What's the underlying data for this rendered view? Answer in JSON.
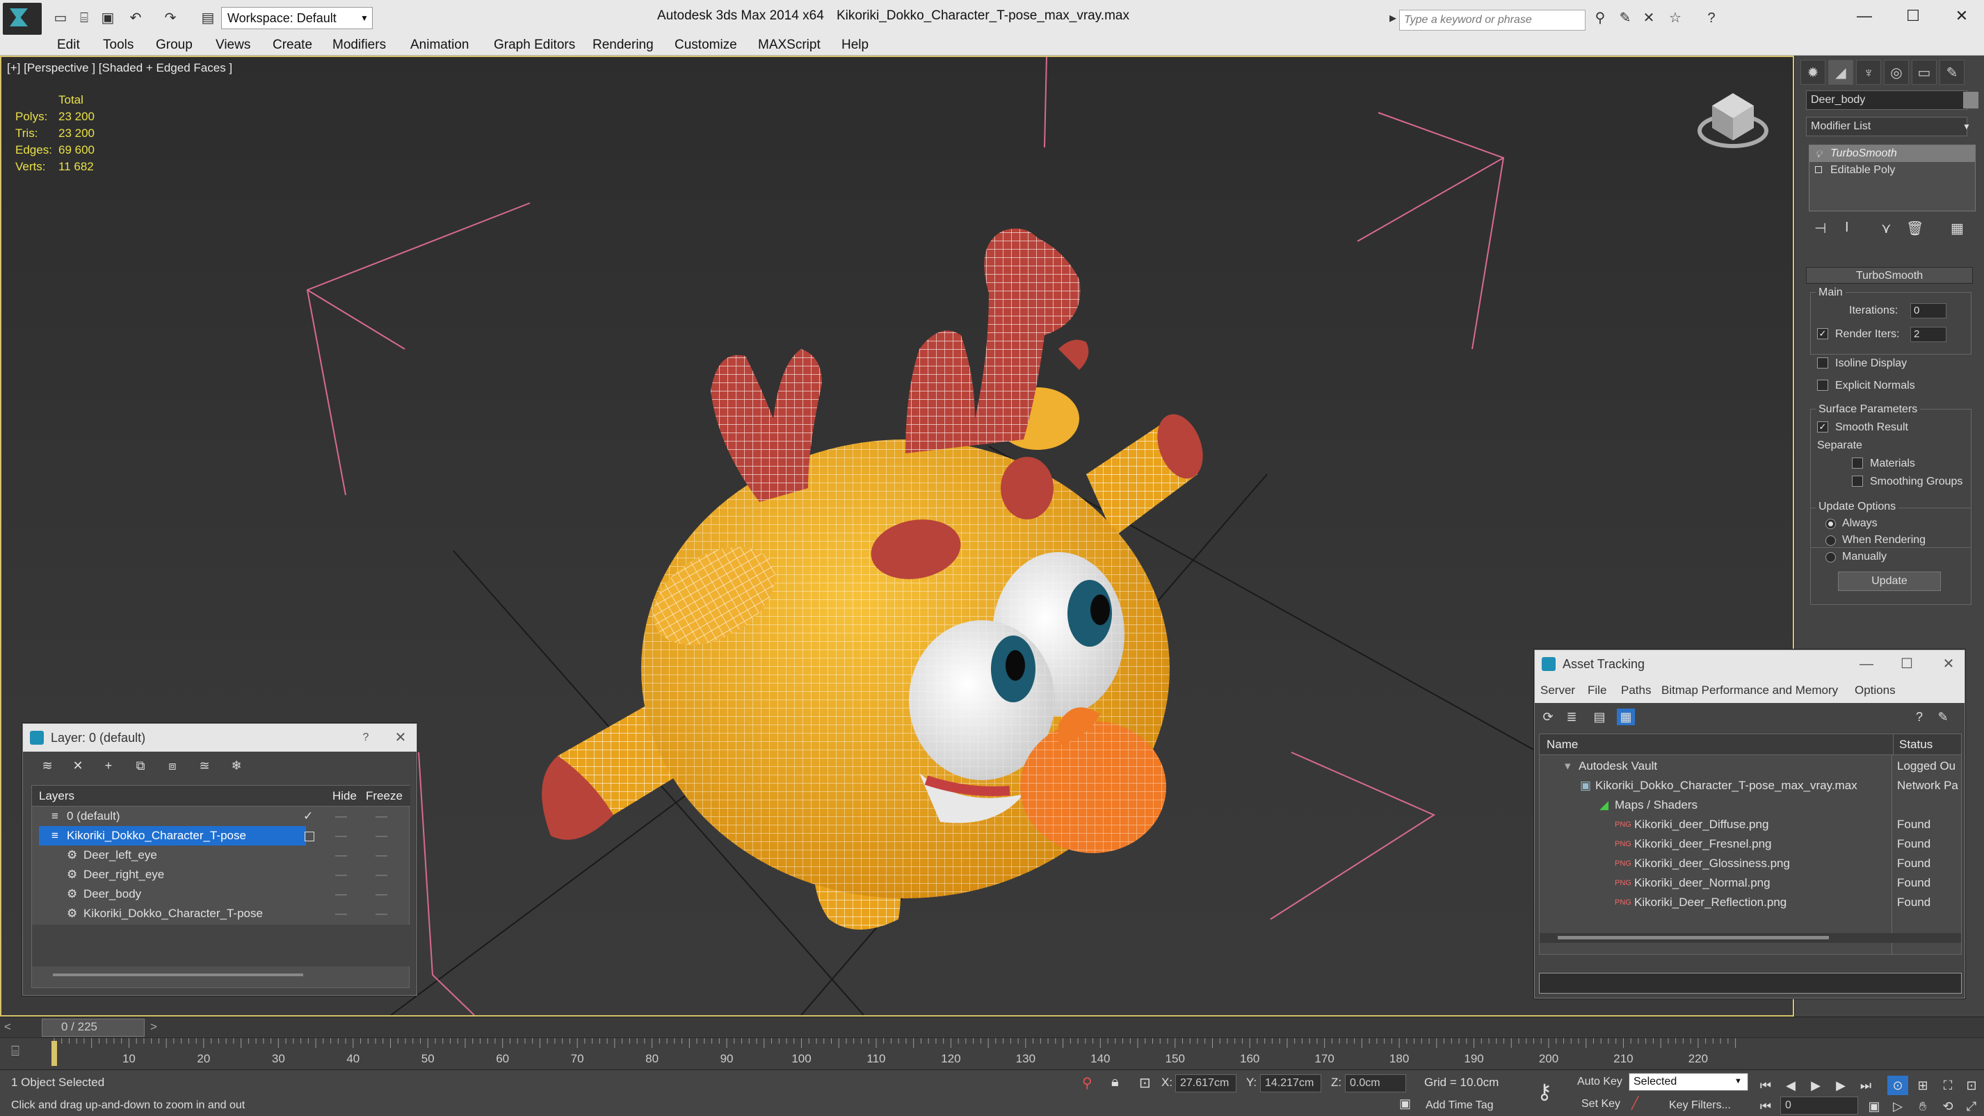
{
  "title_bar": {
    "app_title": "Autodesk 3ds Max  2014 x64",
    "file_title": "Kikoriki_Dokko_Character_T-pose_max_vray.max",
    "workspace": "Workspace: Default",
    "search_placeholder": "Type a keyword or phrase"
  },
  "menu": [
    "Edit",
    "Tools",
    "Group",
    "Views",
    "Create",
    "Modifiers",
    "Animation",
    "Graph Editors",
    "Rendering",
    "Customize",
    "MAXScript",
    "Help"
  ],
  "viewport": {
    "label": "[+] [Perspective ] [Shaded + Edged Faces ]",
    "stats": {
      "total_label": "Total",
      "rows": [
        {
          "label": "Polys:",
          "value": "23 200"
        },
        {
          "label": "Tris:",
          "value": "23 200"
        },
        {
          "label": "Edges:",
          "value": "69 600"
        },
        {
          "label": "Verts:",
          "value": "11 682"
        }
      ]
    }
  },
  "command_panel": {
    "object_name": "Deer_body",
    "modifier_list": "Modifier List",
    "stack": [
      "TurboSmooth",
      "Editable Poly"
    ],
    "rollout_title": "TurboSmooth",
    "main_group": "Main",
    "iterations_label": "Iterations:",
    "iterations_value": "0",
    "render_iters_label": "Render Iters:",
    "render_iters_value": "2",
    "isoline_display": "Isoline Display",
    "explicit_normals": "Explicit Normals",
    "surface_params": "Surface Parameters",
    "smooth_result": "Smooth Result",
    "separate": "Separate",
    "materials": "Materials",
    "smoothing_groups": "Smoothing Groups",
    "update_options": "Update Options",
    "always": "Always",
    "when_rendering": "When Rendering",
    "manually": "Manually",
    "update_button": "Update"
  },
  "layer_dialog": {
    "title": "Layer: 0 (default)",
    "help": "?",
    "columns": {
      "layers": "Layers",
      "hide": "Hide",
      "freeze": "Freeze"
    },
    "rows": [
      {
        "name": "0 (default)",
        "indent": 0
      },
      {
        "name": "Kikoriki_Dokko_Character_T-pose",
        "indent": 0,
        "selected": true
      },
      {
        "name": "Deer_left_eye",
        "indent": 1
      },
      {
        "name": "Deer_right_eye",
        "indent": 1
      },
      {
        "name": "Deer_body",
        "indent": 1
      },
      {
        "name": "Kikoriki_Dokko_Character_T-pose",
        "indent": 1
      }
    ]
  },
  "asset_dialog": {
    "title": "Asset Tracking",
    "menu": [
      "Server",
      "File",
      "Paths",
      "Bitmap Performance and Memory",
      "Options"
    ],
    "columns": {
      "name": "Name",
      "status": "Status"
    },
    "rows": [
      {
        "name": "Autodesk Vault",
        "status": "Logged Ou",
        "indent": 1
      },
      {
        "name": "Kikoriki_Dokko_Character_T-pose_max_vray.max",
        "status": "Network Pa",
        "indent": 2
      },
      {
        "name": "Maps / Shaders",
        "status": "",
        "indent": 3
      },
      {
        "name": "Kikoriki_deer_Diffuse.png",
        "status": "Found",
        "indent": 4
      },
      {
        "name": "Kikoriki_deer_Fresnel.png",
        "status": "Found",
        "indent": 4
      },
      {
        "name": "Kikoriki_deer_Glossiness.png",
        "status": "Found",
        "indent": 4
      },
      {
        "name": "Kikoriki_deer_Normal.png",
        "status": "Found",
        "indent": 4
      },
      {
        "name": "Kikoriki_Deer_Reflection.png",
        "status": "Found",
        "indent": 4
      }
    ]
  },
  "timeline": {
    "frame_counter": "0 / 225",
    "ticks": [
      "10",
      "20",
      "30",
      "40",
      "50",
      "60",
      "70",
      "80",
      "90",
      "100",
      "110",
      "120",
      "130",
      "140",
      "150",
      "160",
      "170",
      "180",
      "190",
      "200",
      "210",
      "220"
    ]
  },
  "status_bar": {
    "selection": "1 Object Selected",
    "prompt": "Click and drag up-and-down to zoom in and out",
    "x_label": "X:",
    "x_value": "27.617cm",
    "y_label": "Y:",
    "y_value": "14.217cm",
    "z_label": "Z:",
    "z_value": "0.0cm",
    "grid": "Grid = 10.0cm",
    "add_time_tag": "Add Time Tag",
    "auto_key": "Auto Key",
    "selected": "Selected",
    "set_key": "Set Key",
    "key_filters": "Key Filters...",
    "current_frame": "0"
  },
  "colors": {
    "viewport_border": "#d8c46a",
    "selection": "#1f6fd0",
    "stats_text": "#e8e048",
    "character_body": "#e8a21c",
    "antler": "#b8433a",
    "nose": "#f07a25"
  }
}
